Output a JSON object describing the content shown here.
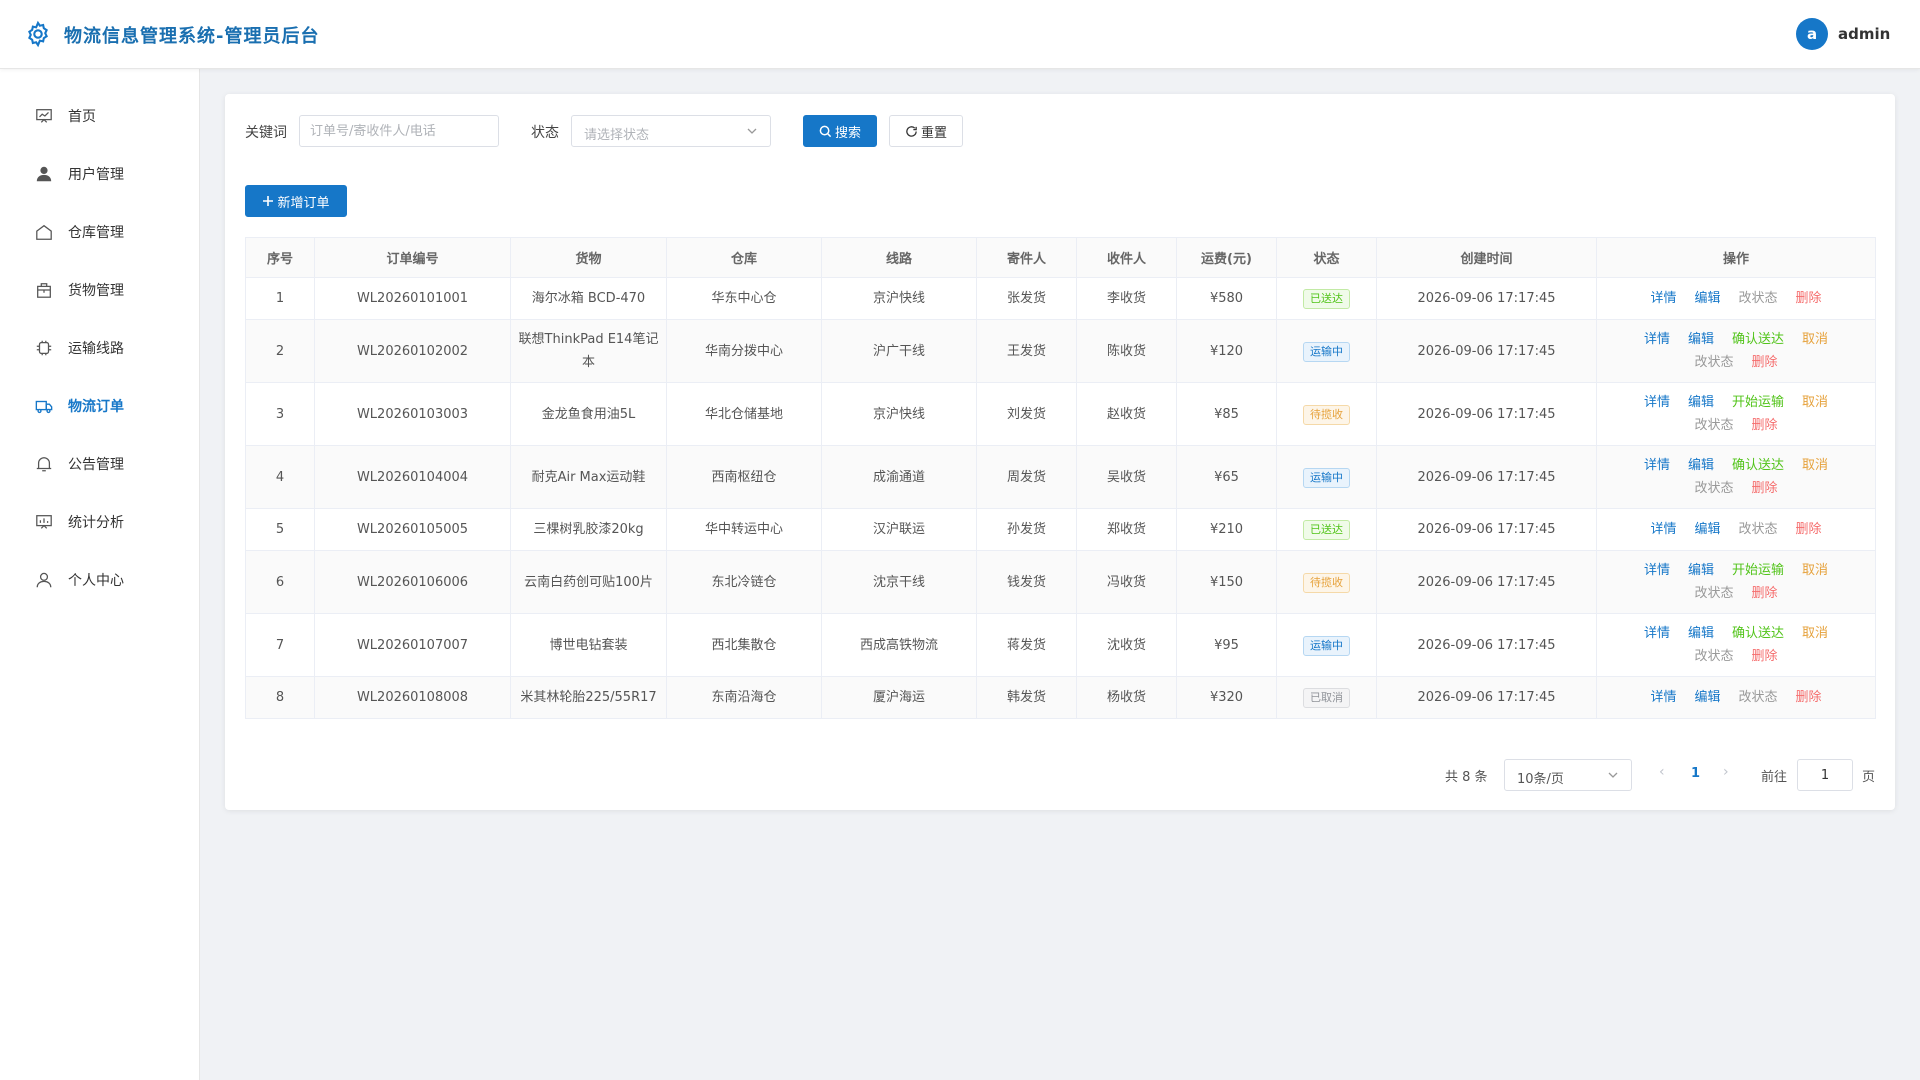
{
  "header": {
    "logo_icon": "gear-icon",
    "title": "物流信息管理系统-管理员后台",
    "avatar_letter": "a",
    "username": "admin",
    "accent_color": "#1677c8"
  },
  "sidebar": {
    "items": [
      {
        "label": "首页",
        "icon": "dashboard-icon",
        "active": false
      },
      {
        "label": "用户管理",
        "icon": "user-icon",
        "active": false
      },
      {
        "label": "仓库管理",
        "icon": "warehouse-icon",
        "active": false
      },
      {
        "label": "货物管理",
        "icon": "package-icon",
        "active": false
      },
      {
        "label": "运输线路",
        "icon": "route-icon",
        "active": false
      },
      {
        "label": "物流订单",
        "icon": "truck-icon",
        "active": true
      },
      {
        "label": "公告管理",
        "icon": "bell-icon",
        "active": false
      },
      {
        "label": "统计分析",
        "icon": "chart-icon",
        "active": false
      },
      {
        "label": "个人中心",
        "icon": "person-icon",
        "active": false
      }
    ]
  },
  "filters": {
    "keyword_label": "关键词",
    "keyword_placeholder": "订单号/寄收件人/电话",
    "keyword_value": "",
    "status_label": "状态",
    "status_placeholder": "请选择状态",
    "search_label": "搜索",
    "reset_label": "重置"
  },
  "toolbar": {
    "add_label": "新增订单"
  },
  "table": {
    "columns": [
      "序号",
      "订单编号",
      "货物",
      "仓库",
      "线路",
      "寄件人",
      "收件人",
      "运费(元)",
      "状态",
      "创建时间",
      "操作"
    ],
    "rows": [
      {
        "idx": "1",
        "order_no": "WL20260101001",
        "goods": "海尔冰箱 BCD-470",
        "warehouse": "华东中心仓",
        "route": "京沪快线",
        "sender": "张发货",
        "receiver": "李收货",
        "fee": "¥580",
        "status": "已送达",
        "status_type": "success",
        "created": "2026-09-06 17:17:45",
        "ops": [
          {
            "label": "详情",
            "type": "blue"
          },
          {
            "label": "编辑",
            "type": "blue"
          },
          {
            "label": "改状态",
            "type": "gray"
          },
          {
            "label": "删除",
            "type": "red"
          }
        ]
      },
      {
        "idx": "2",
        "order_no": "WL20260102002",
        "goods": "联想ThinkPad E14笔记本",
        "warehouse": "华南分拨中心",
        "route": "沪广干线",
        "sender": "王发货",
        "receiver": "陈收货",
        "fee": "¥120",
        "status": "运输中",
        "status_type": "primary",
        "created": "2026-09-06 17:17:45",
        "ops": [
          {
            "label": "详情",
            "type": "blue"
          },
          {
            "label": "编辑",
            "type": "blue"
          },
          {
            "label": "确认送达",
            "type": "green"
          },
          {
            "label": "取消",
            "type": "orange"
          },
          {
            "label": "改状态",
            "type": "gray"
          },
          {
            "label": "删除",
            "type": "red"
          }
        ]
      },
      {
        "idx": "3",
        "order_no": "WL20260103003",
        "goods": "金龙鱼食用油5L",
        "warehouse": "华北仓储基地",
        "route": "京沪快线",
        "sender": "刘发货",
        "receiver": "赵收货",
        "fee": "¥85",
        "status": "待揽收",
        "status_type": "warning",
        "created": "2026-09-06 17:17:45",
        "ops": [
          {
            "label": "详情",
            "type": "blue"
          },
          {
            "label": "编辑",
            "type": "blue"
          },
          {
            "label": "开始运输",
            "type": "green"
          },
          {
            "label": "取消",
            "type": "orange"
          },
          {
            "label": "改状态",
            "type": "gray"
          },
          {
            "label": "删除",
            "type": "red"
          }
        ]
      },
      {
        "idx": "4",
        "order_no": "WL20260104004",
        "goods": "耐克Air Max运动鞋",
        "warehouse": "西南枢纽仓",
        "route": "成渝通道",
        "sender": "周发货",
        "receiver": "吴收货",
        "fee": "¥65",
        "status": "运输中",
        "status_type": "primary",
        "created": "2026-09-06 17:17:45",
        "ops": [
          {
            "label": "详情",
            "type": "blue"
          },
          {
            "label": "编辑",
            "type": "blue"
          },
          {
            "label": "确认送达",
            "type": "green"
          },
          {
            "label": "取消",
            "type": "orange"
          },
          {
            "label": "改状态",
            "type": "gray"
          },
          {
            "label": "删除",
            "type": "red"
          }
        ]
      },
      {
        "idx": "5",
        "order_no": "WL20260105005",
        "goods": "三棵树乳胶漆20kg",
        "warehouse": "华中转运中心",
        "route": "汉沪联运",
        "sender": "孙发货",
        "receiver": "郑收货",
        "fee": "¥210",
        "status": "已送达",
        "status_type": "success",
        "created": "2026-09-06 17:17:45",
        "ops": [
          {
            "label": "详情",
            "type": "blue"
          },
          {
            "label": "编辑",
            "type": "blue"
          },
          {
            "label": "改状态",
            "type": "gray"
          },
          {
            "label": "删除",
            "type": "red"
          }
        ]
      },
      {
        "idx": "6",
        "order_no": "WL20260106006",
        "goods": "云南白药创可贴100片",
        "warehouse": "东北冷链仓",
        "route": "沈京干线",
        "sender": "钱发货",
        "receiver": "冯收货",
        "fee": "¥150",
        "status": "待揽收",
        "status_type": "warning",
        "created": "2026-09-06 17:17:45",
        "ops": [
          {
            "label": "详情",
            "type": "blue"
          },
          {
            "label": "编辑",
            "type": "blue"
          },
          {
            "label": "开始运输",
            "type": "green"
          },
          {
            "label": "取消",
            "type": "orange"
          },
          {
            "label": "改状态",
            "type": "gray"
          },
          {
            "label": "删除",
            "type": "red"
          }
        ]
      },
      {
        "idx": "7",
        "order_no": "WL20260107007",
        "goods": "博世电钻套装",
        "warehouse": "西北集散仓",
        "route": "西成高铁物流",
        "sender": "蒋发货",
        "receiver": "沈收货",
        "fee": "¥95",
        "status": "运输中",
        "status_type": "primary",
        "created": "2026-09-06 17:17:45",
        "ops": [
          {
            "label": "详情",
            "type": "blue"
          },
          {
            "label": "编辑",
            "type": "blue"
          },
          {
            "label": "确认送达",
            "type": "green"
          },
          {
            "label": "取消",
            "type": "orange"
          },
          {
            "label": "改状态",
            "type": "gray"
          },
          {
            "label": "删除",
            "type": "red"
          }
        ]
      },
      {
        "idx": "8",
        "order_no": "WL20260108008",
        "goods": "米其林轮胎225/55R17",
        "warehouse": "东南沿海仓",
        "route": "厦沪海运",
        "sender": "韩发货",
        "receiver": "杨收货",
        "fee": "¥320",
        "status": "已取消",
        "status_type": "info",
        "created": "2026-09-06 17:17:45",
        "ops": [
          {
            "label": "详情",
            "type": "blue"
          },
          {
            "label": "编辑",
            "type": "blue"
          },
          {
            "label": "改状态",
            "type": "gray"
          },
          {
            "label": "删除",
            "type": "red"
          }
        ]
      }
    ]
  },
  "pagination": {
    "total_text": "共 8 条",
    "page_size": "10条/页",
    "current_page": "1",
    "goto_label": "前往",
    "goto_value": "1",
    "page_suffix": "页"
  }
}
